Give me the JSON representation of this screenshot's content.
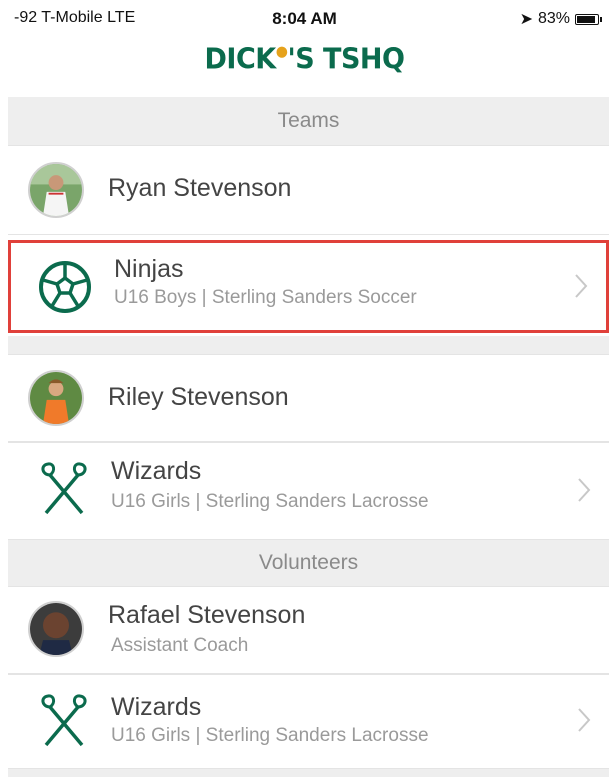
{
  "status": {
    "carrier": "-92 T-Mobile  LTE",
    "time": "8:04 AM",
    "battery": "83%"
  },
  "brand": {
    "logo_text_left": "DICK",
    "logo_text_right": "'S TSHQ",
    "accent": "#0b6b4d"
  },
  "sections": {
    "teams_label": "Teams",
    "volunteers_label": "Volunteers"
  },
  "people": [
    {
      "name": "Ryan Stevenson"
    },
    {
      "name": "Riley Stevenson"
    },
    {
      "name": "Rafael Stevenson",
      "role": "Assistant Coach"
    }
  ],
  "teams": [
    {
      "name": "Ninjas",
      "detail": "U16 Boys | Sterling Sanders Soccer",
      "icon": "soccer-ball-icon"
    },
    {
      "name": "Wizards",
      "detail": "U16 Girls | Sterling Sanders Lacrosse",
      "icon": "lacrosse-sticks-icon"
    },
    {
      "name": "Wizards",
      "detail": "U16 Girls | Sterling Sanders Lacrosse",
      "icon": "lacrosse-sticks-icon"
    }
  ]
}
